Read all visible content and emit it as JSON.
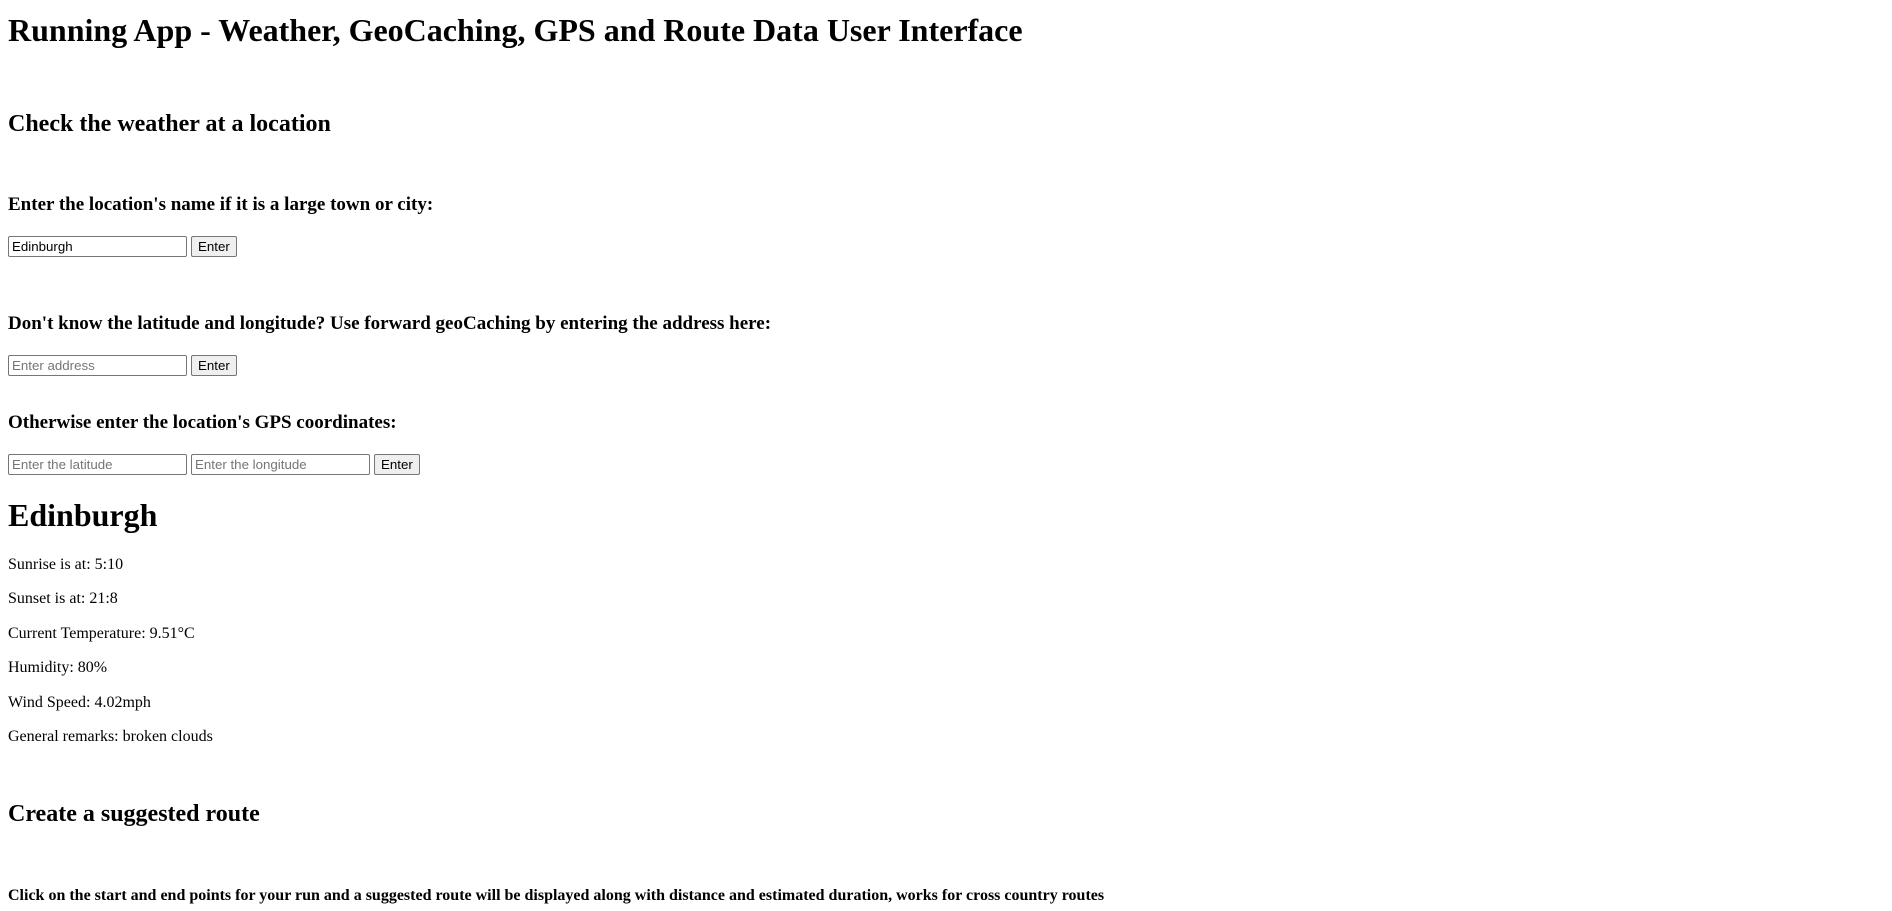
{
  "page": {
    "title": "Running App - Weather, GeoCaching, GPS and Route Data User Interface"
  },
  "weather_section": {
    "heading": "Check the weather at a location",
    "city": {
      "label": "Enter the location's name if it is a large town or city:",
      "value": "Edinburgh",
      "button": "Enter"
    },
    "address": {
      "label": "Don't know the latitude and longitude? Use forward geoCaching by entering the address here:",
      "placeholder": "Enter address",
      "button": "Enter"
    },
    "gps": {
      "label": "Otherwise enter the location's GPS coordinates:",
      "lat_placeholder": "Enter the latitude",
      "lon_placeholder": "Enter the longitude",
      "button": "Enter"
    }
  },
  "weather_result": {
    "location": "Edinburgh",
    "sunrise": "Sunrise is at: 5:10",
    "sunset": "Sunset is at: 21:8",
    "temperature": "Current Temperature: 9.51°C",
    "humidity": "Humidity: 80%",
    "wind": "Wind Speed: 4.02mph",
    "remarks": "General remarks: broken clouds"
  },
  "route_section": {
    "heading": "Create a suggested route",
    "instructions": "Click on the start and end points for your run and a suggested route will be displayed along with distance and estimated duration, works for cross country routes"
  }
}
